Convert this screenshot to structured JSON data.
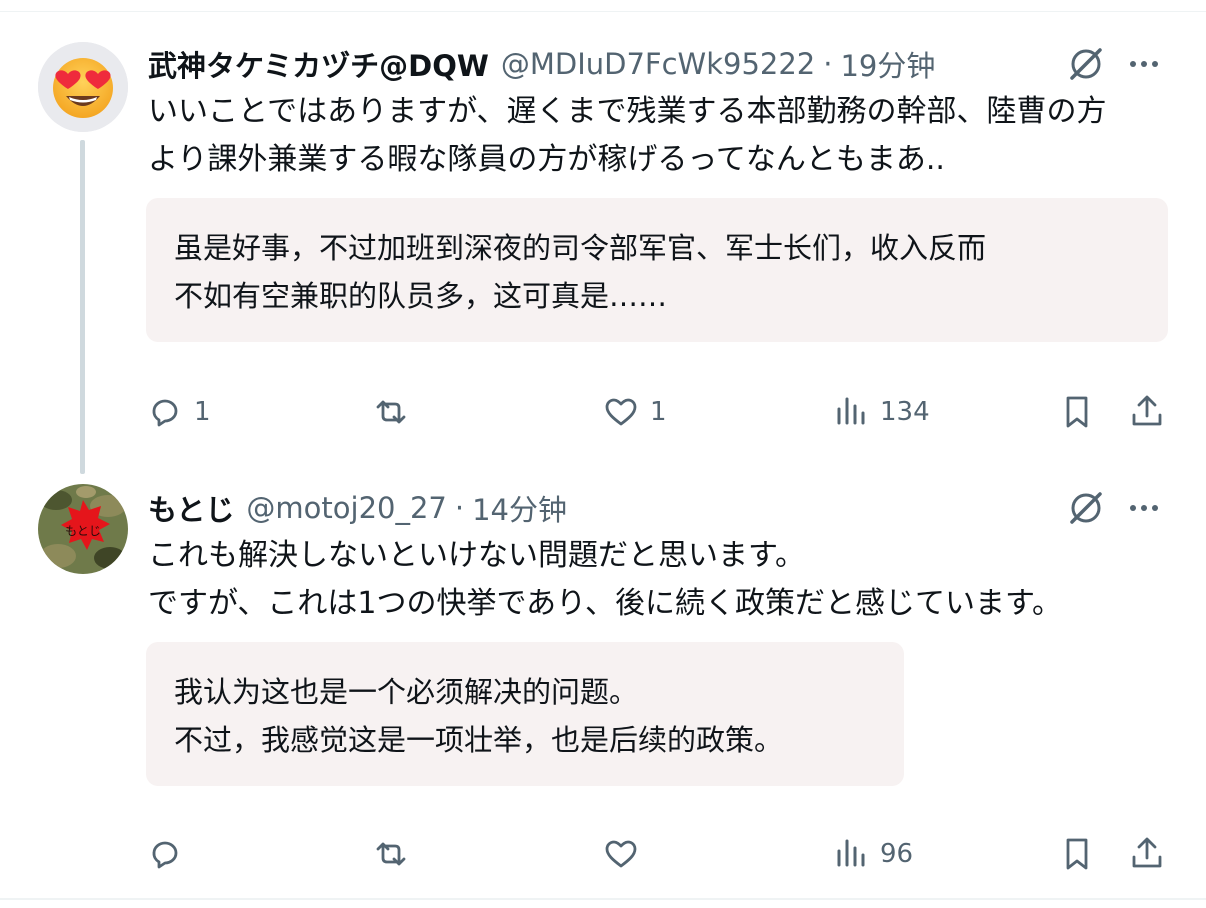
{
  "tweets": [
    {
      "display_name": "武神タケミカヅチ@DQW",
      "handle": "@MDIuD7FcWk95222",
      "separator": "·",
      "time": "19分钟",
      "avatar_icon": "heart-eyes-emoji-icon",
      "body_lines": [
        "いいことではありますが、遅くまで残業する本部勤務の幹部、陸曹の方",
        "より課外兼業する暇な隊員の方が稼げるってなんともまあ.."
      ],
      "translation_lines": [
        "虽是好事，不过加班到深夜的司令部军官、军士长们，收入反而",
        "不如有空兼职的队员多，这可真是……"
      ],
      "stats": {
        "replies": "1",
        "retweets": "",
        "likes": "1",
        "views": "134"
      }
    },
    {
      "display_name": "もとじ",
      "handle": "@motoj20_27",
      "separator": "·",
      "time": "14分钟",
      "avatar_icon": "camo-badge-avatar-icon",
      "avatar_text": "もとじ",
      "body_lines": [
        "これも解決しないといけない問題だと思います。",
        "ですが、これは1つの快挙であり、後に続く政策だと感じています。"
      ],
      "translation_lines": [
        "我认为这也是一个必须解决的问题。",
        "不过，我感觉这是一项壮举，也是后续的政策。"
      ],
      "stats": {
        "replies": "",
        "retweets": "",
        "likes": "",
        "views": "96"
      }
    }
  ],
  "colors": {
    "text_primary": "#0f1419",
    "text_secondary": "#536471",
    "translation_bg": "#f7f2f2",
    "thread_line": "#cfd9de"
  }
}
